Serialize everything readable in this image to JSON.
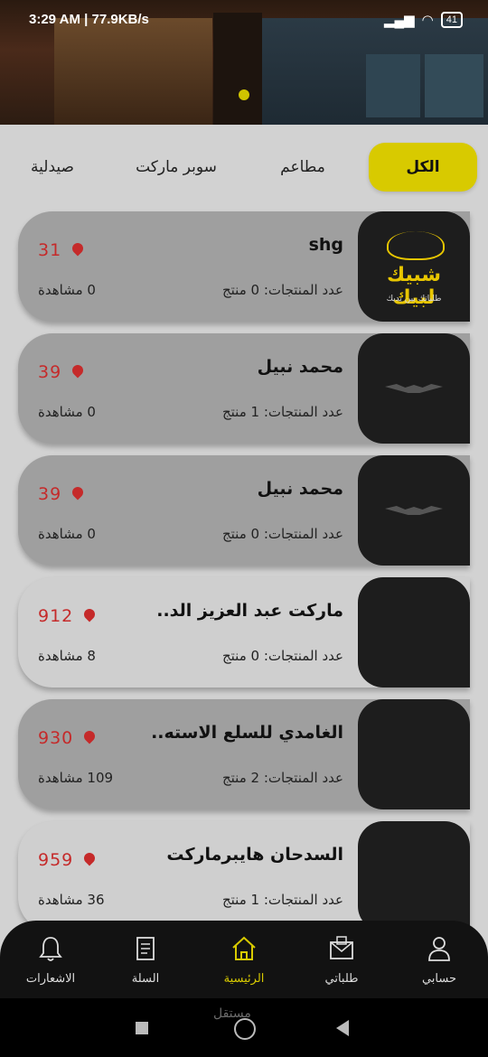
{
  "status_bar": {
    "time": "3:29 AM",
    "speed": "| 77.9KB/s",
    "battery": "41"
  },
  "tabs": [
    {
      "label": "الكل",
      "active": true
    },
    {
      "label": "مطاعم",
      "active": false
    },
    {
      "label": "سوبر ماركت",
      "active": false
    },
    {
      "label": "صيدلية",
      "active": false
    }
  ],
  "stores": [
    {
      "name": "shg",
      "distance": "31",
      "products": "عدد المنتجات: 0 منتج",
      "views": "0 مشاهدة",
      "logo_text": "شبيك لبيك",
      "logo_sub": "طلباتك بين يديك",
      "style": "dark",
      "image": "lamp-logo"
    },
    {
      "name": "محمد نبيل",
      "distance": "39",
      "products": "عدد المنتجات: 1 منتج",
      "views": "0 مشاهدة",
      "style": "dark",
      "image": "bat-logo"
    },
    {
      "name": "محمد نبيل",
      "distance": "39",
      "products": "عدد المنتجات: 0 منتج",
      "views": "0 مشاهدة",
      "style": "dark",
      "image": "bat-logo"
    },
    {
      "name": "ماركت عبد العزيز الد..",
      "distance": "912",
      "products": "عدد المنتجات: 0 منتج",
      "views": "8 مشاهدة",
      "style": "light",
      "image": "market-photo"
    },
    {
      "name": "الغامدي للسلع الاسته..",
      "distance": "930",
      "products": "عدد المنتجات: 2 منتج",
      "views": "109 مشاهدة",
      "style": "dark",
      "image": "market-photo"
    },
    {
      "name": "السدحان هايبرماركت",
      "distance": "959",
      "products": "عدد المنتجات: 1 منتج",
      "views": "36 مشاهدة",
      "style": "light",
      "image": "market-photo"
    }
  ],
  "bottom_nav": [
    {
      "label": "الاشعارات",
      "icon": "bell-icon",
      "active": false
    },
    {
      "label": "السلة",
      "icon": "cart-icon",
      "active": false
    },
    {
      "label": "الرئيسية",
      "icon": "home-icon",
      "active": true
    },
    {
      "label": "طلباتي",
      "icon": "orders-icon",
      "active": false
    },
    {
      "label": "حسابي",
      "icon": "user-icon",
      "active": false
    }
  ],
  "watermark": "مستقل",
  "colors": {
    "accent": "#d8ca00",
    "distance": "#c52a2a",
    "nav_bg": "#121212"
  }
}
